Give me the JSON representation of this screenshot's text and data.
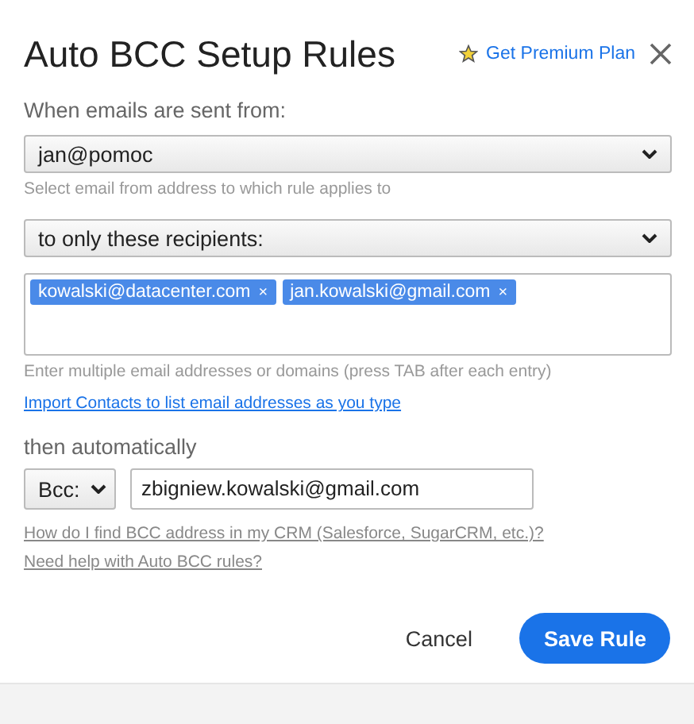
{
  "title": "Auto BCC Setup Rules",
  "premium_link": "Get Premium Plan",
  "from_label": "When emails are sent from:",
  "from_select": "jan@pomoc",
  "from_hint": "Select email from address to which rule applies to",
  "recipients_select": "to only these recipients:",
  "recipients": [
    {
      "email": "kowalski@datacenter.com",
      "remove": "×"
    },
    {
      "email": "jan.kowalski@gmail.com",
      "remove": "×"
    }
  ],
  "recipients_hint": "Enter multiple email addresses or domains (press TAB after each entry)",
  "import_link": "Import Contacts to list email addresses as you type",
  "then_label": "then automatically",
  "bcc_select": "Bcc:",
  "bcc_address": "zbigniew.kowalski@gmail.com",
  "help_links": [
    "How do I find BCC address in my CRM (Salesforce, SugarCRM, etc.)?",
    "Need help with Auto BCC rules?"
  ],
  "cancel_button": "Cancel",
  "save_button": "Save Rule"
}
